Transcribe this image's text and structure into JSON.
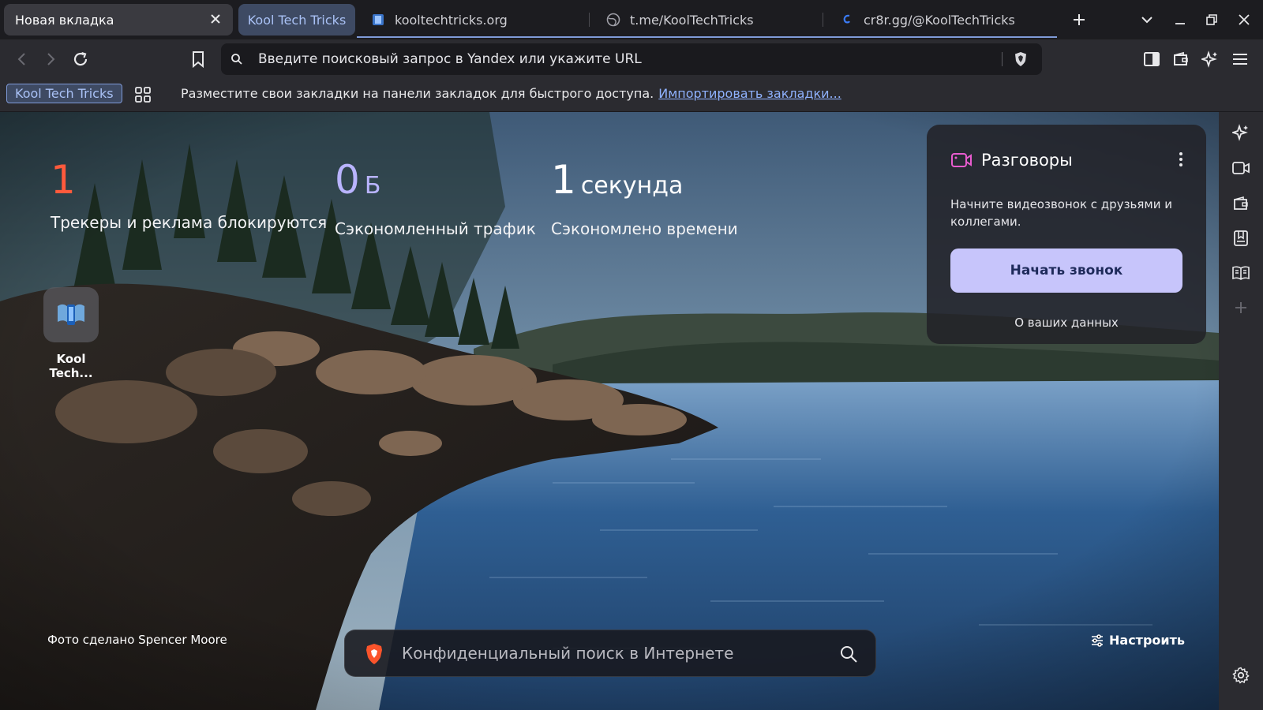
{
  "tabs": {
    "active": {
      "label": "Новая вкладка"
    },
    "group": {
      "label": "Kool Tech Tricks"
    },
    "items": [
      {
        "label": "kooltechtricks.org",
        "icon": "site-favicon-icon"
      },
      {
        "label": "t.me/KoolTechTricks",
        "icon": "globe-icon"
      },
      {
        "label": "cr8r.gg/@KoolTechTricks",
        "icon": "creator-favicon-icon"
      }
    ]
  },
  "omnibox": {
    "placeholder": "Введите поисковый запрос в Yandex или укажите URL"
  },
  "bookmarks_bar": {
    "group_label": "Kool Tech Tricks",
    "message": "Разместите свои закладки на панели закладок для быстрого доступа.",
    "import_link": "Импортировать закладки..."
  },
  "stats": [
    {
      "value": "1",
      "unit": "",
      "label": "Трекеры и реклама блокируются",
      "color": "#ff5a3c"
    },
    {
      "value": "0",
      "unit": "Б",
      "label": "Сэкономленный трафик",
      "color": "#b9b4ff"
    },
    {
      "value": "1",
      "unit": "секунда",
      "label": "Сэкономлено времени",
      "color": "#ffffff"
    }
  ],
  "top_site": {
    "label": "Kool Tech..."
  },
  "talk": {
    "title": "Разговоры",
    "description": "Начните видеозвонок с друзьями и коллегами.",
    "button": "Начать звонок",
    "privacy_link": "О ваших данных"
  },
  "photo_credit": "Фото сделано Spencer Moore",
  "search": {
    "placeholder": "Конфиденциальный поиск в Интернете"
  },
  "customize": {
    "label": "Настроить"
  },
  "colors": {
    "accent_blue": "#7f9ad8",
    "talk_button": "#c7c5fb",
    "tracker_count": "#ff5a3c",
    "bandwidth": "#b9b4ff"
  }
}
